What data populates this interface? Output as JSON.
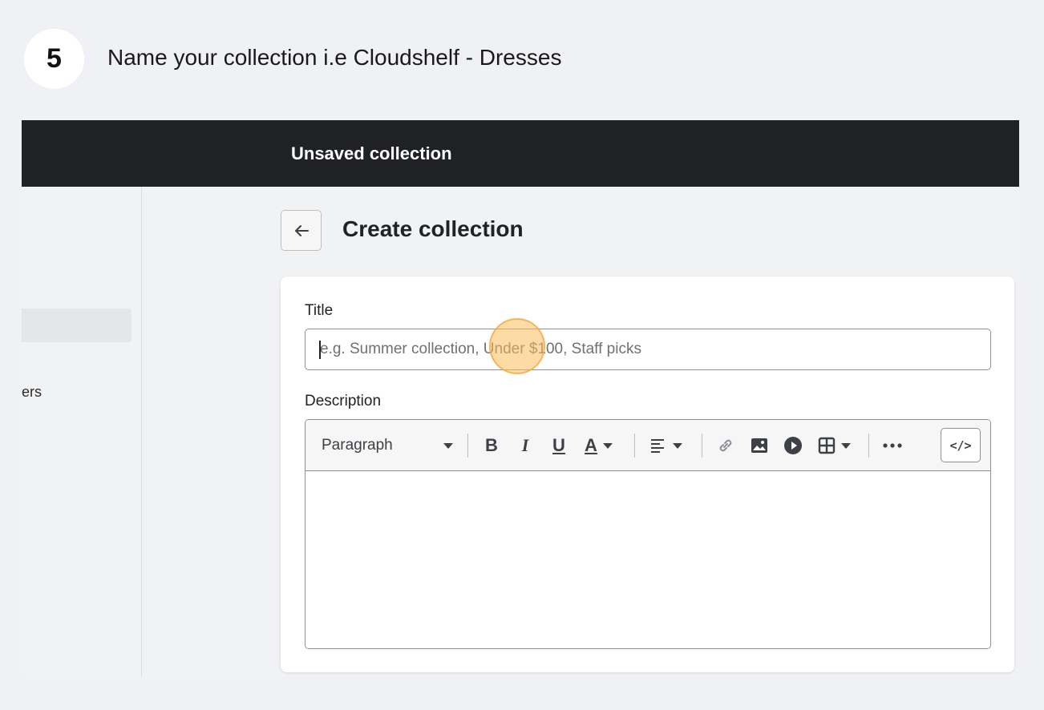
{
  "step": {
    "number": "5",
    "instruction": "Name your collection i.e Cloudshelf - Dresses"
  },
  "topbar": {
    "title": "Unsaved collection"
  },
  "sidebar": {
    "partial_item_label": "ers"
  },
  "page": {
    "title": "Create collection"
  },
  "form": {
    "title_label": "Title",
    "title_value": "",
    "title_placeholder": "e.g. Summer collection, Under $100, Staff picks",
    "description_label": "Description"
  },
  "toolbar": {
    "paragraph_select": "Paragraph",
    "bold": "B",
    "italic": "I",
    "underline": "U",
    "text_color": "A",
    "code_view": "</>"
  },
  "icons": [
    "back-arrow-icon",
    "caret-down-icon",
    "align-left-icon",
    "link-icon",
    "image-icon",
    "video-play-icon",
    "table-icon",
    "more-horizontal-icon",
    "code-icon"
  ],
  "colors": {
    "topbar": "#202124",
    "page_background": "#f1f2f4",
    "click_highlight": "#fabe5a"
  }
}
